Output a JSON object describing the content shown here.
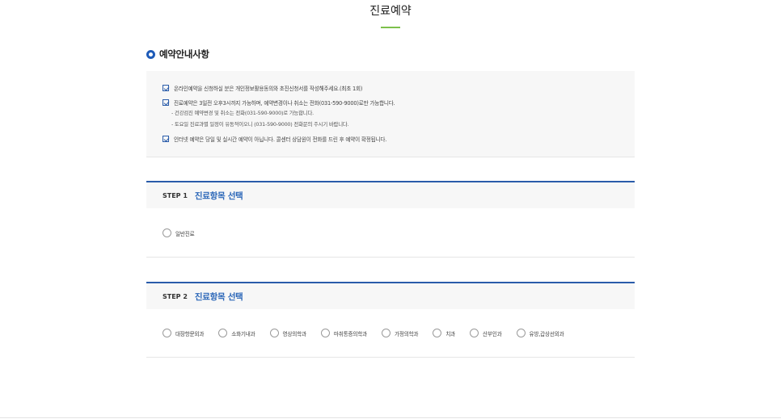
{
  "page": {
    "title": "진료예약"
  },
  "notice": {
    "heading": "예약안내사항",
    "items": [
      "온라인예약을 신청하실 분은 개인정보활용동의와 초진신청서를 작성해주세요.(최초 1회)",
      "진료예약은 3일전 오후3시까지 가능하며, 예약변경이나 취소는 전화(031-590-9000)로만 가능합니다.",
      "인터넷 예약은 당일 및 실시간 예약이 아닙니다. 콜센터 상담원이 전화를 드린 후 예약이 확정됩니다."
    ],
    "sub_items": [
      "- 건강검진 예약변경 및 취소는 전화(031-590-9000)로 가능합니다.",
      "- 토요일 진료과별 일정이 유동적이오니 (031-590-9000) 전화문의 주시기 바랍니다."
    ]
  },
  "step1": {
    "label": "STEP 1",
    "title": "진료항목 선택",
    "options": [
      "일반진료"
    ]
  },
  "step2": {
    "label": "STEP 2",
    "title": "진료항목 선택",
    "options": [
      "대장항문외과",
      "소화기내과",
      "영상의학과",
      "마취통증의학과",
      "가정의학과",
      "치과",
      "산부인과",
      "유방,갑상선외과"
    ]
  },
  "colors": {
    "accent_blue": "#2a5caa",
    "title_underline": "#7cc04b",
    "panel_bg": "#f7f7f7"
  }
}
